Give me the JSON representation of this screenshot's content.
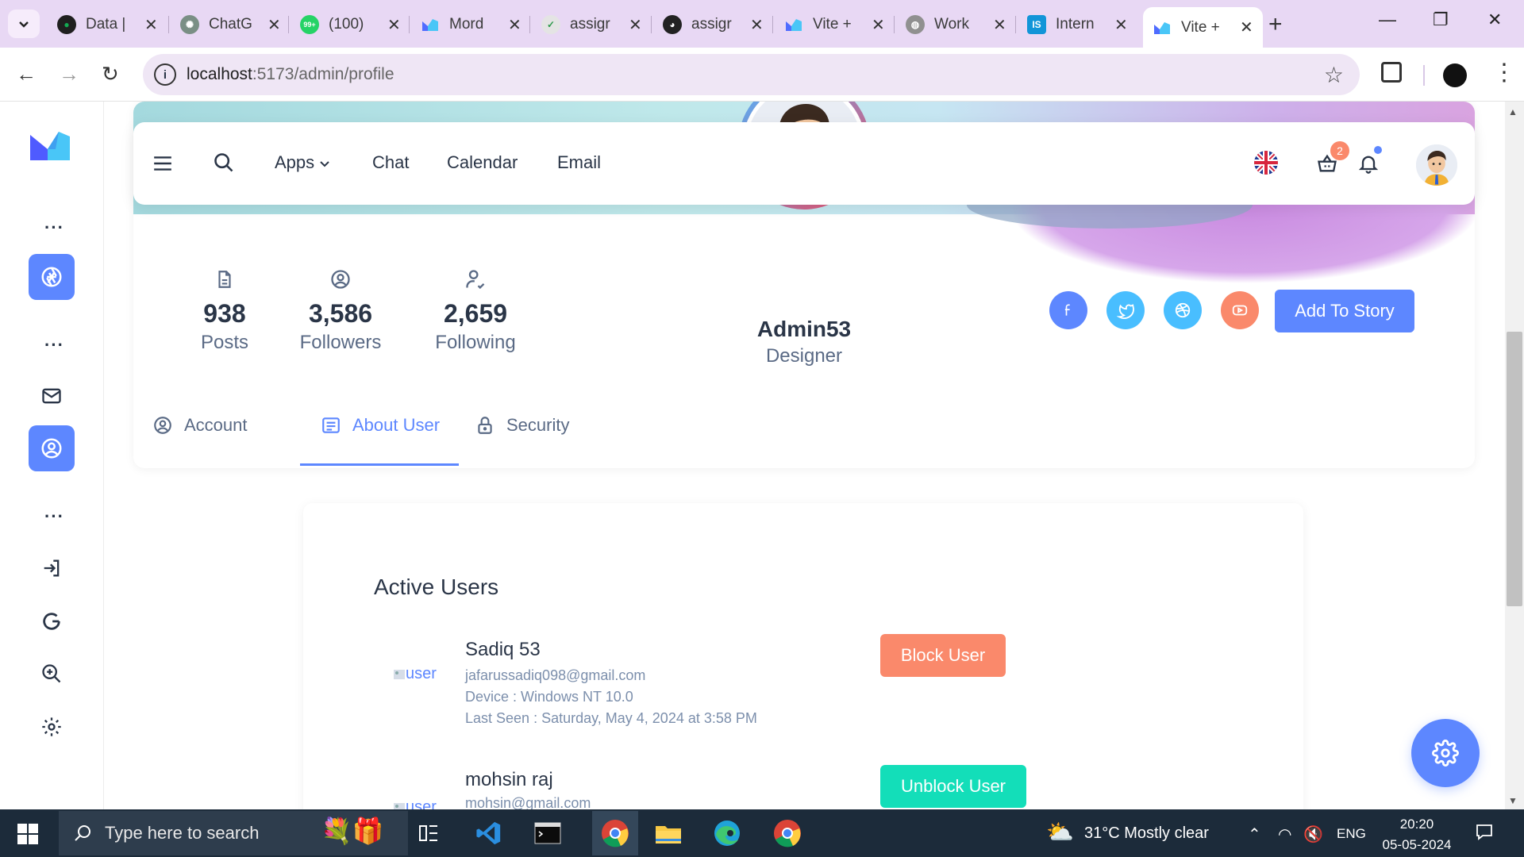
{
  "browser": {
    "tabs": [
      {
        "title": "Data |",
        "icon": "mongodb-icon",
        "color": "#1f1f1f"
      },
      {
        "title": "ChatG",
        "icon": "chatgpt-icon",
        "color": "#7a8f85"
      },
      {
        "title": "(100)",
        "icon": "whatsapp-icon",
        "color": "#25d366"
      },
      {
        "title": "Mord",
        "icon": "modernize-icon",
        "color": "#4f6cff"
      },
      {
        "title": "assigr",
        "icon": "assignment-icon",
        "color": "#6a6a6a"
      },
      {
        "title": "assigr",
        "icon": "github-icon",
        "color": "#222222"
      },
      {
        "title": "Vite +",
        "icon": "vite-icon",
        "color": "#4f6cff"
      },
      {
        "title": "Work",
        "icon": "globe-icon",
        "color": "#808080"
      },
      {
        "title": "Intern",
        "icon": "internshala-icon",
        "color": "#1295d8"
      },
      {
        "title": "Vite +",
        "icon": "vite-icon",
        "color": "#4f6cff"
      }
    ],
    "url_host": "localhost",
    "url_path": ":5173/admin/profile"
  },
  "header": {
    "links": [
      "Apps",
      "Chat",
      "Calendar",
      "Email"
    ],
    "cart_count": "2"
  },
  "profile": {
    "stats": [
      {
        "value": "938",
        "label": "Posts"
      },
      {
        "value": "3,586",
        "label": "Followers"
      },
      {
        "value": "2,659",
        "label": "Following"
      }
    ],
    "name": "Admin53",
    "role": "Designer",
    "story_button": "Add To Story",
    "tabs": [
      "Account",
      "About User",
      "Security"
    ]
  },
  "users": {
    "title": "Active Users",
    "list": [
      {
        "img_alt": "user",
        "name": "Sadiq 53",
        "email": "jafarussadiq098@gmail.com",
        "device": "Device : Windows NT 10.0",
        "last_seen": "Last Seen : Saturday, May 4, 2024 at 3:58 PM",
        "action": "Block User",
        "action_color": "#fa896b"
      },
      {
        "img_alt": "user",
        "name": "mohsin raj",
        "email": "mohsin@gmail.com",
        "action": "Unblock User",
        "action_color": "#13deb9"
      }
    ]
  },
  "taskbar": {
    "search_placeholder": "Type here to search",
    "weather": "31°C  Mostly clear",
    "language": "ENG",
    "time": "20:20",
    "date": "05-05-2024"
  },
  "colors": {
    "primary": "#5d87ff",
    "danger": "#fa896b",
    "success": "#13deb9"
  }
}
